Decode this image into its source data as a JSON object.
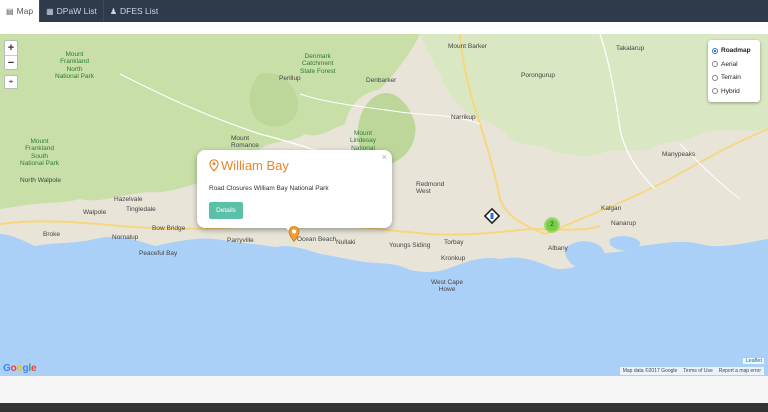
{
  "nav": {
    "tabs": [
      {
        "label": "Map",
        "icon": "map-icon",
        "active": true
      },
      {
        "label": "DPaW List",
        "icon": "list-icon",
        "active": false
      },
      {
        "label": "DFES List",
        "icon": "bell-icon",
        "active": false
      }
    ]
  },
  "map": {
    "zoom_in": "+",
    "zoom_out": "−",
    "layers": [
      {
        "label": "Roadmap",
        "selected": true
      },
      {
        "label": "Aerial",
        "selected": false
      },
      {
        "label": "Terrain",
        "selected": false
      },
      {
        "label": "Hybrid",
        "selected": false
      }
    ],
    "popup": {
      "title": "William Bay",
      "description": "Road Closures William Bay National Park",
      "button": "Details",
      "close": "×"
    },
    "cluster_count": "2",
    "places": {
      "mount_barker": "Mount Barker",
      "takalarup": "Takalarup",
      "denmark_park": "Denmark\nCatchment\nState Forest",
      "mount_frankland": "Mount\nFrankland\nNorth\nNational Park",
      "perillup": "Perillup",
      "denbarker": "Denbarker",
      "porongurup": "Porongurup",
      "narrikup": "Narrikup",
      "mount_romance": "Mount\nRomance",
      "mount_lindesay": "Mount\nLindesay\nNational\nPark",
      "mount_frankland_south": "Mount\nFrankland\nSouth\nNational Park",
      "north_walpole": "North Walpole",
      "manypeaks": "Manypeaks",
      "redmond_west": "Redmond\nWest",
      "hazelvale": "Hazelvale",
      "tingledale": "Tingledale",
      "walpole": "Walpole",
      "kalgan": "Kalgan",
      "nanarup": "Nanarup",
      "broke": "Broke",
      "nornalup": "Nornalup",
      "bow_bridge": "Bow Bridge",
      "parryville": "Parryville",
      "ocean_beach": "Ocean Beach",
      "nullaki": "Nullaki",
      "youngs_siding": "Youngs Siding",
      "torbay": "Torbay",
      "albany": "Albany",
      "peaceful_bay": "Peaceful Bay",
      "kronkup": "Kronkup",
      "west_cape_howe": "West Cape\nHowe"
    },
    "google": [
      "G",
      "o",
      "o",
      "g",
      "l",
      "e"
    ],
    "attribution": [
      "Map data ©2017 Google",
      "Terms of Use",
      "Report a map error"
    ],
    "leaflet": "Leaflet"
  }
}
